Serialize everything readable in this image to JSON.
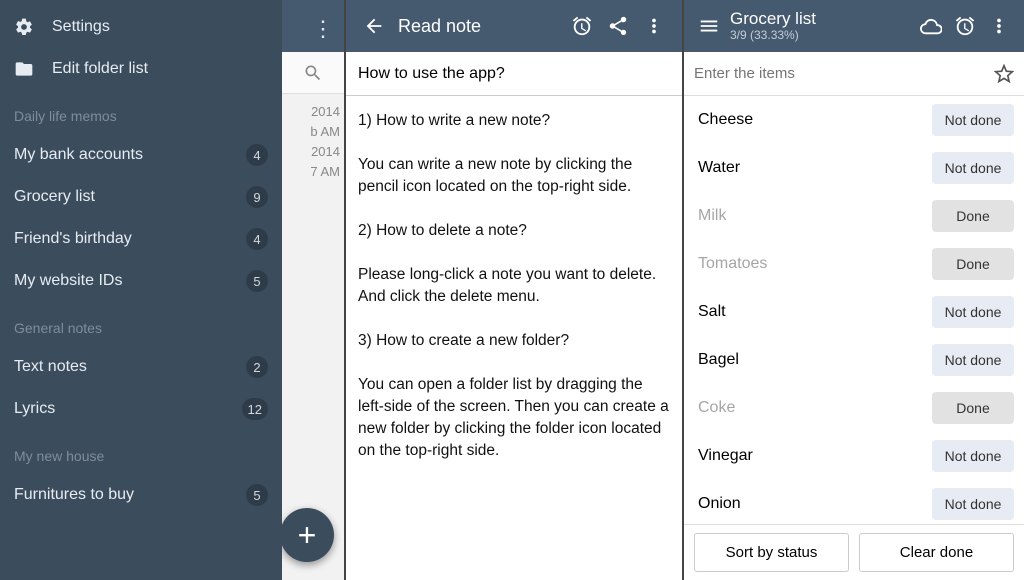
{
  "colors": {
    "header_bg": "#455a6e",
    "drawer_bg": "#3b4c5c"
  },
  "left_panel": {
    "top_actions": {
      "settings_label": "Settings",
      "edit_folders_label": "Edit folder list"
    },
    "sections": [
      {
        "header": "Daily life memos",
        "items": [
          {
            "name": "My bank accounts",
            "count": 4
          },
          {
            "name": "Grocery list",
            "count": 9
          },
          {
            "name": "Friend's birthday",
            "count": 4
          },
          {
            "name": "My website IDs",
            "count": 5
          }
        ]
      },
      {
        "header": "General notes",
        "items": [
          {
            "name": "Text notes",
            "count": 2
          },
          {
            "name": "Lyrics",
            "count": 12
          }
        ]
      },
      {
        "header": "My new house",
        "items": [
          {
            "name": "Furnitures to buy",
            "count": 5
          }
        ]
      }
    ],
    "background_peek": {
      "lines": [
        "2014",
        "b AM",
        "2014",
        "7 AM"
      ]
    }
  },
  "middle_panel": {
    "header_title": "Read note",
    "note_title": "How to use the app?",
    "note_body": "1) How to write a new note?\n\nYou can write a new note by clicking the pencil icon located on the top-right side.\n\n2) How to delete a note?\n\nPlease long-click a note you want to delete. And click the delete menu.\n\n3) How to create a new folder?\n\nYou can open a folder list by dragging the left-side of the screen. Then you can create a new folder by clicking the folder icon located on the top-right side."
  },
  "right_panel": {
    "header_title": "Grocery list",
    "header_subtitle": "3/9 (33.33%)",
    "input_placeholder": "Enter the items",
    "status_labels": {
      "done": "Done",
      "not_done": "Not done"
    },
    "items": [
      {
        "name": "Cheese",
        "done": false
      },
      {
        "name": "Water",
        "done": false
      },
      {
        "name": "Milk",
        "done": true
      },
      {
        "name": "Tomatoes",
        "done": true
      },
      {
        "name": "Salt",
        "done": false
      },
      {
        "name": "Bagel",
        "done": false
      },
      {
        "name": "Coke",
        "done": true
      },
      {
        "name": "Vinegar",
        "done": false
      },
      {
        "name": "Onion",
        "done": false
      }
    ],
    "bottom_buttons": {
      "sort_label": "Sort by status",
      "clear_label": "Clear done"
    }
  }
}
